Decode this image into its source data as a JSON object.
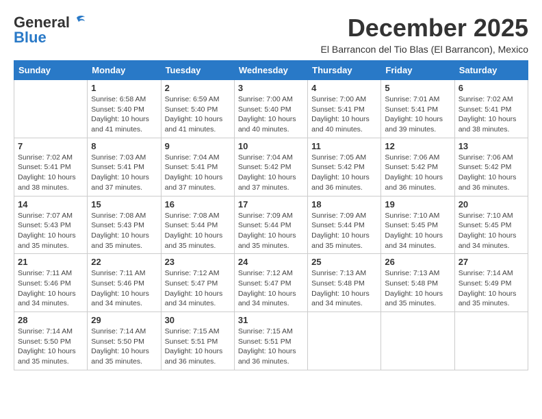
{
  "header": {
    "logo_general": "General",
    "logo_blue": "Blue",
    "month_title": "December 2025",
    "location": "El Barrancon del Tio Blas (El Barrancon), Mexico"
  },
  "weekdays": [
    "Sunday",
    "Monday",
    "Tuesday",
    "Wednesday",
    "Thursday",
    "Friday",
    "Saturday"
  ],
  "weeks": [
    [
      {
        "day": "",
        "info": ""
      },
      {
        "day": "1",
        "info": "Sunrise: 6:58 AM\nSunset: 5:40 PM\nDaylight: 10 hours\nand 41 minutes."
      },
      {
        "day": "2",
        "info": "Sunrise: 6:59 AM\nSunset: 5:40 PM\nDaylight: 10 hours\nand 41 minutes."
      },
      {
        "day": "3",
        "info": "Sunrise: 7:00 AM\nSunset: 5:40 PM\nDaylight: 10 hours\nand 40 minutes."
      },
      {
        "day": "4",
        "info": "Sunrise: 7:00 AM\nSunset: 5:41 PM\nDaylight: 10 hours\nand 40 minutes."
      },
      {
        "day": "5",
        "info": "Sunrise: 7:01 AM\nSunset: 5:41 PM\nDaylight: 10 hours\nand 39 minutes."
      },
      {
        "day": "6",
        "info": "Sunrise: 7:02 AM\nSunset: 5:41 PM\nDaylight: 10 hours\nand 38 minutes."
      }
    ],
    [
      {
        "day": "7",
        "info": "Sunrise: 7:02 AM\nSunset: 5:41 PM\nDaylight: 10 hours\nand 38 minutes."
      },
      {
        "day": "8",
        "info": "Sunrise: 7:03 AM\nSunset: 5:41 PM\nDaylight: 10 hours\nand 37 minutes."
      },
      {
        "day": "9",
        "info": "Sunrise: 7:04 AM\nSunset: 5:41 PM\nDaylight: 10 hours\nand 37 minutes."
      },
      {
        "day": "10",
        "info": "Sunrise: 7:04 AM\nSunset: 5:42 PM\nDaylight: 10 hours\nand 37 minutes."
      },
      {
        "day": "11",
        "info": "Sunrise: 7:05 AM\nSunset: 5:42 PM\nDaylight: 10 hours\nand 36 minutes."
      },
      {
        "day": "12",
        "info": "Sunrise: 7:06 AM\nSunset: 5:42 PM\nDaylight: 10 hours\nand 36 minutes."
      },
      {
        "day": "13",
        "info": "Sunrise: 7:06 AM\nSunset: 5:42 PM\nDaylight: 10 hours\nand 36 minutes."
      }
    ],
    [
      {
        "day": "14",
        "info": "Sunrise: 7:07 AM\nSunset: 5:43 PM\nDaylight: 10 hours\nand 35 minutes."
      },
      {
        "day": "15",
        "info": "Sunrise: 7:08 AM\nSunset: 5:43 PM\nDaylight: 10 hours\nand 35 minutes."
      },
      {
        "day": "16",
        "info": "Sunrise: 7:08 AM\nSunset: 5:44 PM\nDaylight: 10 hours\nand 35 minutes."
      },
      {
        "day": "17",
        "info": "Sunrise: 7:09 AM\nSunset: 5:44 PM\nDaylight: 10 hours\nand 35 minutes."
      },
      {
        "day": "18",
        "info": "Sunrise: 7:09 AM\nSunset: 5:44 PM\nDaylight: 10 hours\nand 35 minutes."
      },
      {
        "day": "19",
        "info": "Sunrise: 7:10 AM\nSunset: 5:45 PM\nDaylight: 10 hours\nand 34 minutes."
      },
      {
        "day": "20",
        "info": "Sunrise: 7:10 AM\nSunset: 5:45 PM\nDaylight: 10 hours\nand 34 minutes."
      }
    ],
    [
      {
        "day": "21",
        "info": "Sunrise: 7:11 AM\nSunset: 5:46 PM\nDaylight: 10 hours\nand 34 minutes."
      },
      {
        "day": "22",
        "info": "Sunrise: 7:11 AM\nSunset: 5:46 PM\nDaylight: 10 hours\nand 34 minutes."
      },
      {
        "day": "23",
        "info": "Sunrise: 7:12 AM\nSunset: 5:47 PM\nDaylight: 10 hours\nand 34 minutes."
      },
      {
        "day": "24",
        "info": "Sunrise: 7:12 AM\nSunset: 5:47 PM\nDaylight: 10 hours\nand 34 minutes."
      },
      {
        "day": "25",
        "info": "Sunrise: 7:13 AM\nSunset: 5:48 PM\nDaylight: 10 hours\nand 34 minutes."
      },
      {
        "day": "26",
        "info": "Sunrise: 7:13 AM\nSunset: 5:48 PM\nDaylight: 10 hours\nand 35 minutes."
      },
      {
        "day": "27",
        "info": "Sunrise: 7:14 AM\nSunset: 5:49 PM\nDaylight: 10 hours\nand 35 minutes."
      }
    ],
    [
      {
        "day": "28",
        "info": "Sunrise: 7:14 AM\nSunset: 5:50 PM\nDaylight: 10 hours\nand 35 minutes."
      },
      {
        "day": "29",
        "info": "Sunrise: 7:14 AM\nSunset: 5:50 PM\nDaylight: 10 hours\nand 35 minutes."
      },
      {
        "day": "30",
        "info": "Sunrise: 7:15 AM\nSunset: 5:51 PM\nDaylight: 10 hours\nand 36 minutes."
      },
      {
        "day": "31",
        "info": "Sunrise: 7:15 AM\nSunset: 5:51 PM\nDaylight: 10 hours\nand 36 minutes."
      },
      {
        "day": "",
        "info": ""
      },
      {
        "day": "",
        "info": ""
      },
      {
        "day": "",
        "info": ""
      }
    ]
  ]
}
